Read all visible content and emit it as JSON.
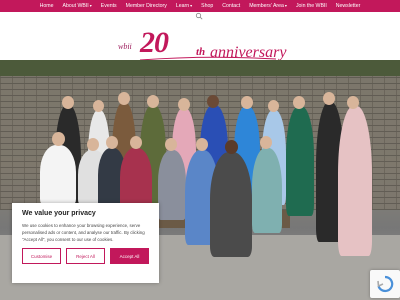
{
  "nav": {
    "items": [
      "Home",
      "About WBII",
      "Events",
      "Member Directory",
      "Learn",
      "Shop",
      "Contact",
      "Members' Area",
      "Join the WBII",
      "Newsletter"
    ],
    "dropdown_caret": "▾"
  },
  "logo": {
    "small_text": "wbii",
    "big_text": "20",
    "sup_text": "th",
    "tail_text": "anniversary"
  },
  "privacy": {
    "title": "We value your privacy",
    "text": "We use cookies to enhance your browsing experience, serve personalised ads or content, and analyse our traffic. By clicking \"Accept All\", you consent to our use of cookies.",
    "customise_label": "Customise",
    "reject_label": "Reject All",
    "accept_label": "Accept All"
  },
  "colors": {
    "brand": "#c2185b",
    "nav_text": "#ffffff"
  },
  "icons": {
    "search": "search-icon",
    "recaptcha": "recaptcha-icon"
  }
}
